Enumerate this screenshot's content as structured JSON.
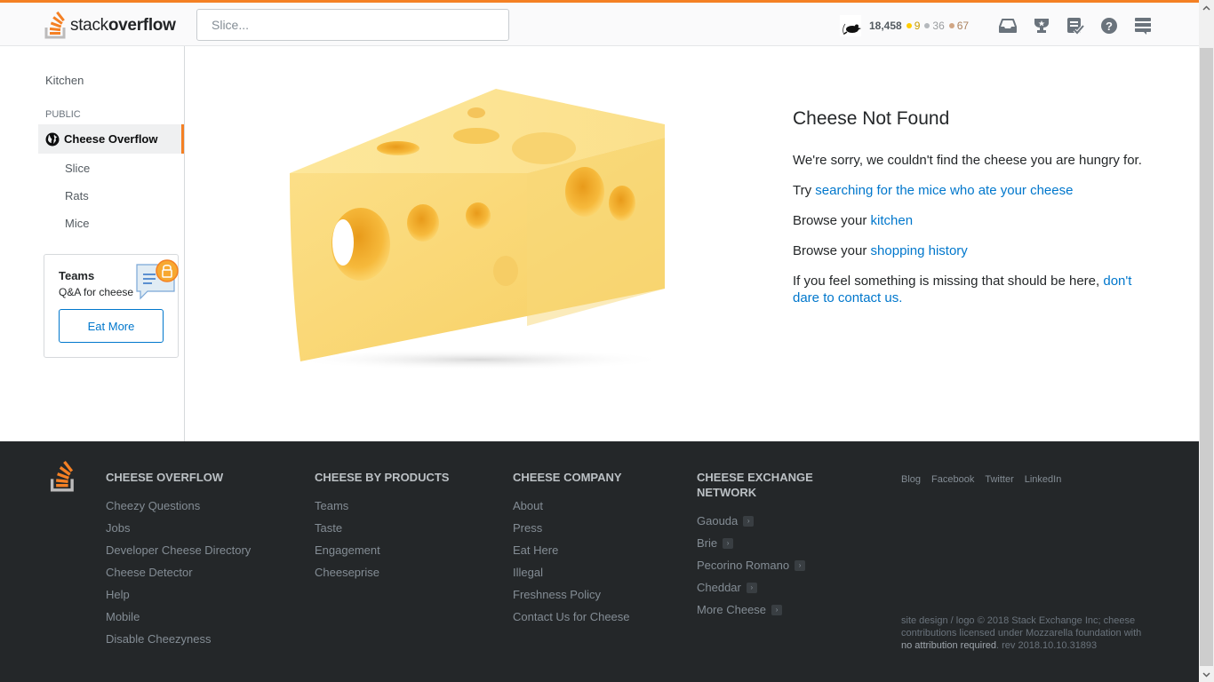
{
  "header": {
    "logo": {
      "prefix": "stack",
      "suffix": "overflow"
    },
    "search_placeholder": "Slice...",
    "user": {
      "avatar_icon": "rat-icon",
      "reputation": "18,458",
      "gold": "9",
      "silver": "36",
      "bronze": "67"
    },
    "icons": [
      "inbox-icon",
      "achievements-icon",
      "review-icon",
      "help-icon",
      "site-switcher-icon"
    ]
  },
  "sidebar": {
    "home": "Kitchen",
    "section": "PUBLIC",
    "active": "Cheese Overflow",
    "items": [
      {
        "label": "Slice"
      },
      {
        "label": "Rats"
      },
      {
        "label": "Mice"
      }
    ],
    "teams": {
      "title": "Teams",
      "subtitle": "Q&A for cheese",
      "button": "Eat More"
    }
  },
  "main": {
    "title": "Cheese Not Found",
    "sorry": "We're sorry, we couldn't find the cheese you are hungry for.",
    "try_prefix": "Try ",
    "try_link": "searching for the mice who ate your cheese",
    "browse1_prefix": "Browse your ",
    "browse1_link": "kitchen",
    "browse2_prefix": "Browse your ",
    "browse2_link": "shopping history",
    "missing_prefix": "If you feel something is missing that should be here, ",
    "missing_link": "don't dare to contact us",
    "missing_suffix": ".",
    "image_alt": "cheese wedge"
  },
  "footer": {
    "columns": [
      {
        "title": "CHEESE OVERFLOW",
        "links": [
          "Cheezy Questions",
          "Jobs",
          "Developer Cheese Directory",
          "Cheese Detector",
          "Help",
          "Mobile",
          "Disable Cheezyness"
        ]
      },
      {
        "title": "CHEESE BY PRODUCTS",
        "links": [
          "Teams",
          "Taste",
          "Engagement",
          "Cheeseprise"
        ]
      },
      {
        "title": "CHEESE COMPANY",
        "links": [
          "About",
          "Press",
          "Eat Here",
          "Illegal",
          "Freshness Policy",
          "Contact Us for Cheese"
        ]
      },
      {
        "title": "CHEESE EXCHANGE NETWORK",
        "links": [
          "Gaouda",
          "Brie",
          "Pecorino Romano",
          "Cheddar",
          "More Cheese"
        ]
      }
    ],
    "social": [
      "Blog",
      "Facebook",
      "Twitter",
      "LinkedIn"
    ],
    "copyright_line": "site design / logo © 2018 Stack Exchange Inc; cheese contributions licensed under Mozzarella foundation with ",
    "copyright_na": "no attribution required",
    "copyright_rev": ". rev 2018.10.10.31893"
  },
  "colors": {
    "accent": "#f48024",
    "link": "#0077cc",
    "footer_bg": "#242729"
  }
}
